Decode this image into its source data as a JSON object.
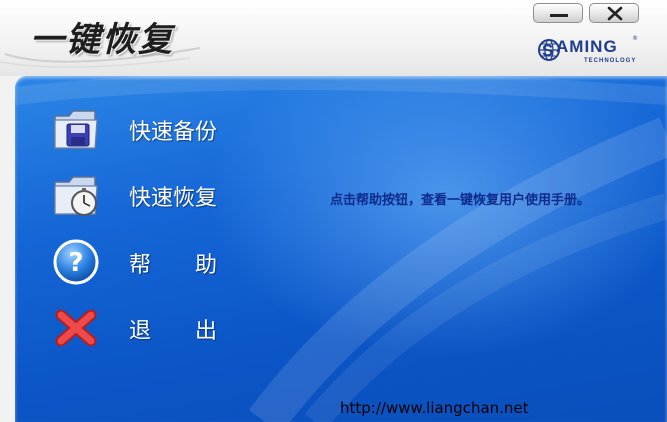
{
  "window": {
    "title": "一键恢复",
    "minimize_icon": "minimize-icon",
    "close_icon": "close-icon"
  },
  "logo": {
    "word": "AMING",
    "sub": "TECHNOLOGY",
    "reg": "®",
    "letter_s": "S",
    "brand_color": "#1f3d8c"
  },
  "menu": {
    "backup": {
      "label": "快速备份",
      "icon": "floppy-folder-icon"
    },
    "restore": {
      "label": "快速恢复",
      "icon": "stopwatch-folder-icon"
    },
    "help": {
      "label_1": "帮",
      "label_2": "助",
      "icon": "help-question-icon"
    },
    "exit": {
      "label_1": "退",
      "label_2": "出",
      "icon": "exit-x-icon"
    }
  },
  "hint": "点击帮助按钮，查看一键恢复用户使用手册。",
  "website": "http://www.liangchan.net",
  "colors": {
    "panel_blue": "#1566d6",
    "hint_text": "#0d2a8c",
    "label_text": "#ffffff"
  }
}
